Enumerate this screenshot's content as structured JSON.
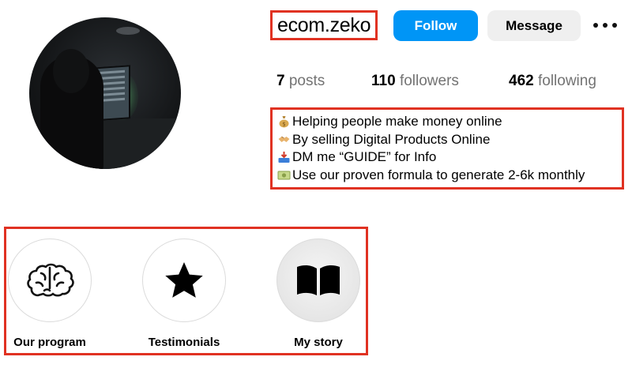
{
  "profile": {
    "username": "ecom.zeko",
    "follow_label": "Follow",
    "message_label": "Message",
    "more_icon": "more-options-icon"
  },
  "stats": {
    "posts_count": "7",
    "posts_label": "posts",
    "followers_count": "110",
    "followers_label": "followers",
    "following_count": "462",
    "following_label": "following"
  },
  "bio": [
    {
      "icon": "money-bag-emoji",
      "text": "Helping people make money online"
    },
    {
      "icon": "handshake-emoji",
      "text": "By selling Digital Products Online"
    },
    {
      "icon": "inbox-tray-emoji",
      "text": "DM me “GUIDE” for Info"
    },
    {
      "icon": "dollar-banknote-emoji",
      "text": "Use our proven formula to generate 2-6k monthly"
    }
  ],
  "highlights": [
    {
      "label": "Our program",
      "icon": "brain-icon"
    },
    {
      "label": "Testimonials",
      "icon": "star-icon"
    },
    {
      "label": "My story",
      "icon": "open-book-icon"
    }
  ],
  "colors": {
    "accent_blue": "#0095f6",
    "annotation_red": "#e03222",
    "secondary_button": "#efefef",
    "muted_text": "#737373"
  }
}
